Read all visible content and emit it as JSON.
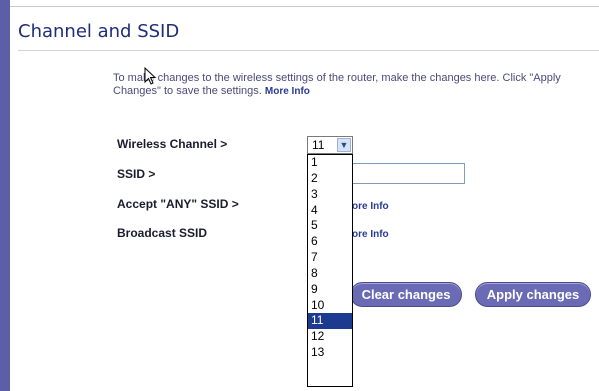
{
  "page": {
    "title": "Channel and SSID",
    "intro_text": "To make changes to the wireless settings of the router, make the changes here. Click \"Apply Changes\" to save the settings.",
    "intro_more": "More Info"
  },
  "form": {
    "channel_label": "Wireless Channel >",
    "channel_value": "11",
    "ssid_label": "SSID >",
    "ssid_value": "",
    "accept_any_label": "Accept \"ANY\" SSID >",
    "accept_any_more": "ore Info",
    "broadcast_label": "Broadcast SSID",
    "broadcast_more": "ore Info"
  },
  "channel_options": [
    "1",
    "2",
    "3",
    "4",
    "5",
    "6",
    "7",
    "8",
    "9",
    "10",
    "11",
    "12",
    "13"
  ],
  "buttons": {
    "clear": "Clear changes",
    "apply": "Apply changes"
  },
  "colors": {
    "accent": "#5c5fa8",
    "button": "#6b6bb5",
    "selected_option": "#1c3a8f"
  }
}
